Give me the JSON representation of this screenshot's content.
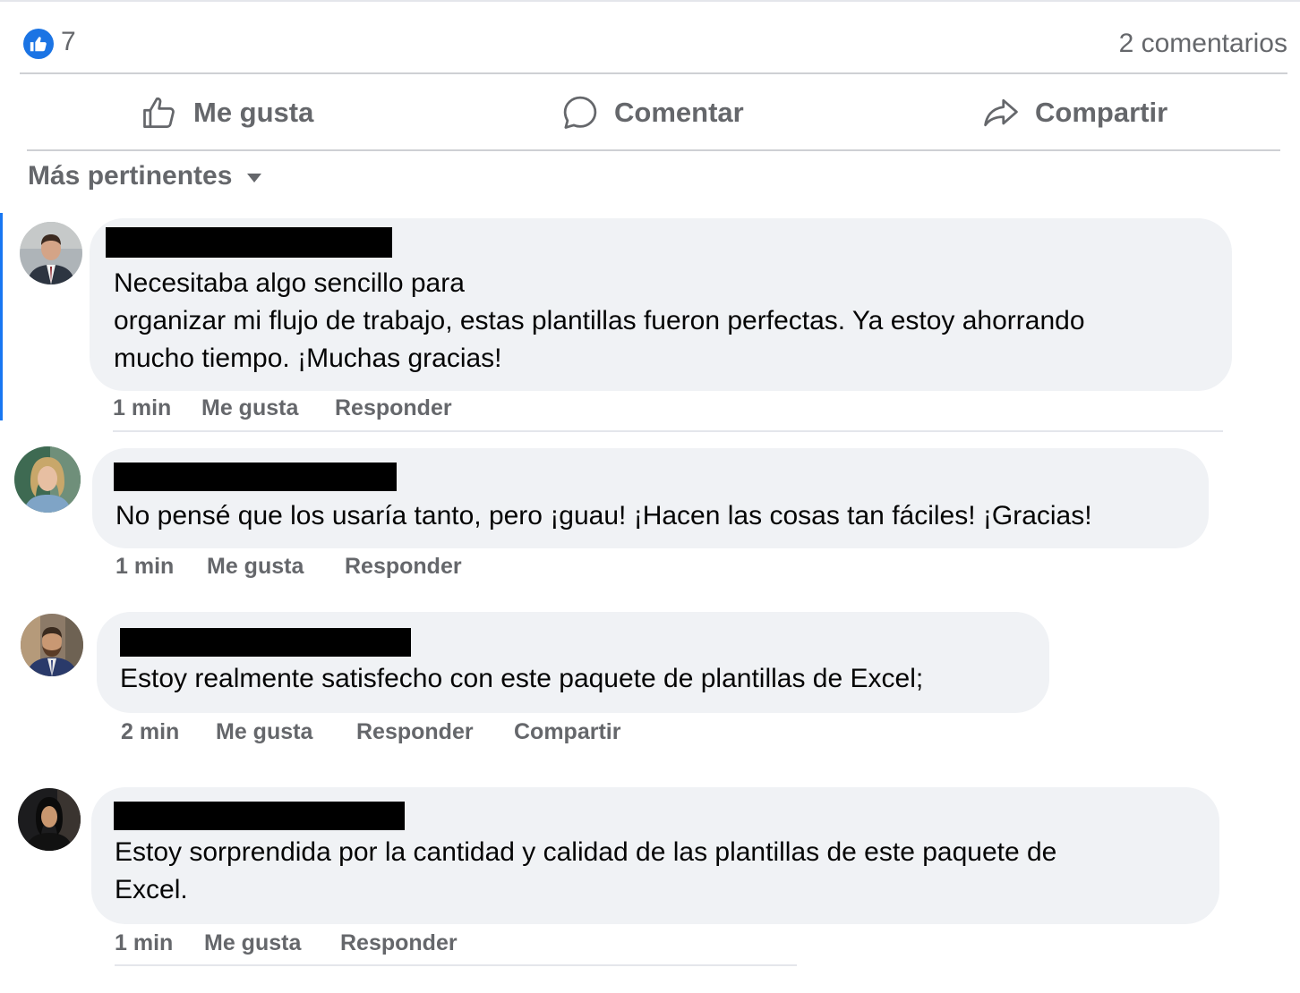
{
  "summary": {
    "like_count": "7",
    "comments_count": "2 comentarios"
  },
  "actions": {
    "like": "Me gusta",
    "comment": "Comentar",
    "share": "Compartir"
  },
  "sort": {
    "label": "Más pertinentes"
  },
  "comments": [
    {
      "lines": [
        "Necesitaba algo sencillo para",
        "organizar mi flujo de trabajo, estas plantillas fueron perfectas. Ya estoy ahorrando",
        "mucho tiempo. ¡Muchas gracias!"
      ],
      "time": "1 min",
      "like": "Me gusta",
      "reply": "Responder"
    },
    {
      "lines": [
        "No pensé que los usaría tanto, pero ¡guau! ¡Hacen las cosas tan fáciles! ¡Gracias!"
      ],
      "time": "1 min",
      "like": "Me gusta",
      "reply": "Responder"
    },
    {
      "lines": [
        "Estoy realmente satisfecho con este paquete de plantillas de Excel;"
      ],
      "time": "2 min",
      "like": "Me gusta",
      "reply": "Responder",
      "share": "Compartir"
    },
    {
      "lines": [
        "Estoy sorprendida por la cantidad y calidad de las plantillas de este paquete de",
        "Excel."
      ],
      "time": "1 min",
      "like": "Me gusta",
      "reply": "Responder"
    }
  ],
  "icons": {
    "reaction": "like-reaction-icon",
    "like": "thumbs-up-icon",
    "comment": "speech-bubble-icon",
    "share": "share-arrow-icon",
    "sort": "caret-down-icon"
  },
  "colors": {
    "accent": "#1b74e4",
    "muted_text": "#65676b",
    "bubble": "#f0f2f5"
  }
}
